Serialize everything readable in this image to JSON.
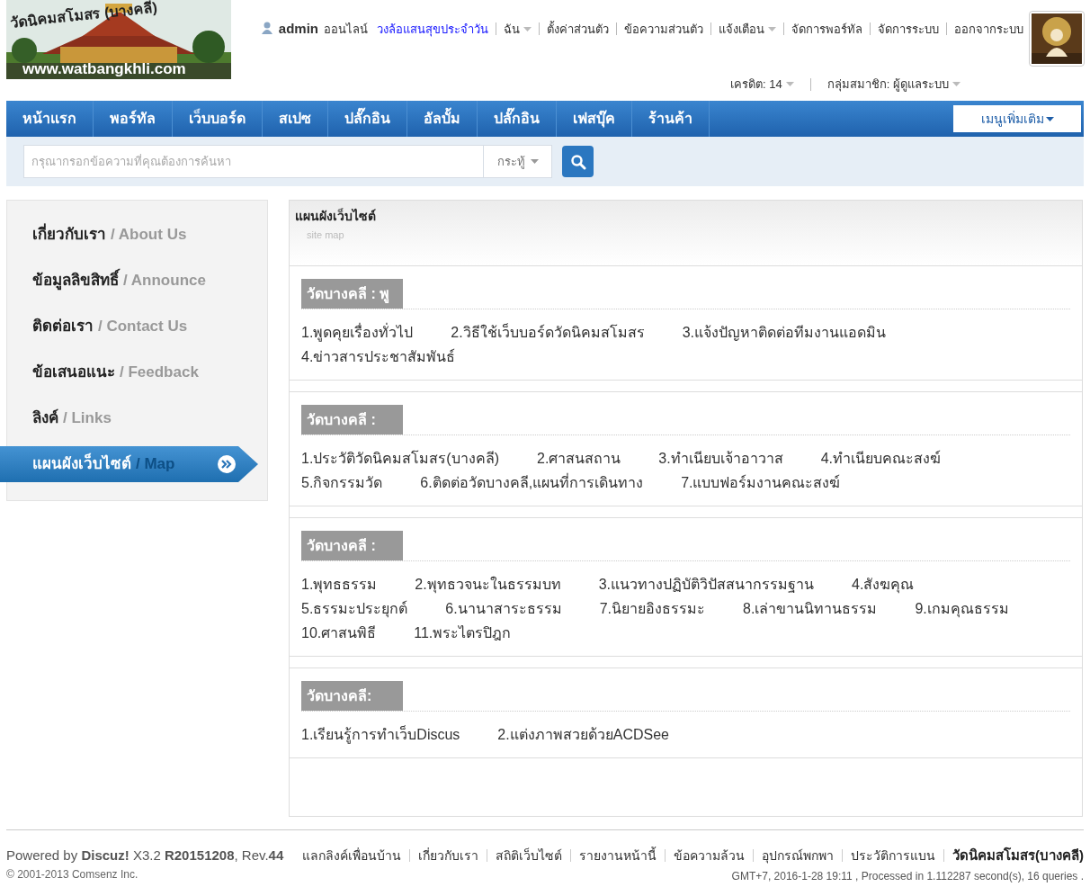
{
  "logo": {
    "title": "วัดนิคมสโมสร (บางคลี)",
    "url": "www.watbangkhli.com"
  },
  "user_bar": {
    "username": "admin",
    "status": "ออนไลน์",
    "highlight_link": "วงล้อแสนสุขประจำวัน",
    "links": [
      {
        "label": "ฉัน",
        "dropdown": true
      },
      {
        "label": "ตั้งค่าส่วนตัว",
        "dropdown": false
      },
      {
        "label": "ข้อความส่วนตัว",
        "dropdown": false
      },
      {
        "label": "แจ้งเตือน",
        "dropdown": true
      },
      {
        "label": "จัดการพอร์ทัล",
        "dropdown": false
      },
      {
        "label": "จัดการระบบ",
        "dropdown": false
      },
      {
        "label": "ออกจากระบบ",
        "dropdown": false
      }
    ],
    "info": [
      {
        "label": "เครดิต: 14",
        "dropdown": true
      },
      {
        "label": "กลุ่มสมาชิก: ผู้ดูแลระบบ",
        "dropdown": true
      }
    ]
  },
  "nav": {
    "items": [
      "หน้าแรก",
      "พอร์ทัล",
      "เว็บบอร์ด",
      "สเปซ",
      "ปลั๊กอิน",
      "อัลบั้ม",
      "ปลั๊กอิน",
      "เฟสบุ๊ค",
      "ร้านค้า"
    ],
    "more_button": "เมนูเพิ่มเติม"
  },
  "search": {
    "placeholder": "กรุณากรอกข้อความที่คุณต้องการค้นหา",
    "scope": "กระทู้"
  },
  "sidebar": {
    "items": [
      {
        "thai": "เกี่ยวกับเรา",
        "english": "/ About Us",
        "selected": false
      },
      {
        "thai": "ข้อมูลลิขสิทธิ์",
        "english": "/ Announce",
        "selected": false
      },
      {
        "thai": "ติดต่อเรา",
        "english": "/ Contact Us",
        "selected": false
      },
      {
        "thai": "ข้อเสนอแนะ",
        "english": "/ Feedback",
        "selected": false
      },
      {
        "thai": "ลิงค์",
        "english": "/ Links",
        "selected": false
      },
      {
        "thai": "แผนผังเว็บไซต์",
        "english": "/ Map",
        "selected": true
      }
    ]
  },
  "content": {
    "title": "แผนผังเว็บไซต์",
    "subtitle": "site map",
    "sections": [
      {
        "heading": "วัดบางคลี : พู",
        "links": [
          "1.พูดคุยเรื่องทั่วไป",
          "2.วิธีใช้เว็บบอร์ดวัดนิคมสโมสร",
          "3.แจ้งปัญหาติดต่อทีมงานแอดมิน",
          "4.ข่าวสารประชาสัมพันธ์"
        ]
      },
      {
        "heading": "วัดบางคลี :",
        "links": [
          "1.ประวัติวัดนิคมสโมสร(บางคลี)",
          "2.ศาสนสถาน",
          "3.ทำเนียบเจ้าอาวาส",
          "4.ทำเนียบคณะสงฆ์",
          "5.กิจกรรมวัด",
          "6.ติดต่อวัดบางคลี,แผนที่การเดินทาง",
          "7.แบบฟอร์มงานคณะสงฆ์"
        ]
      },
      {
        "heading": "วัดบางคลี :",
        "links": [
          "1.พุทธธรรม",
          "2.พุทธวจนะในธรรมบท",
          "3.แนวทางปฏิบัติวิปัสสนากรรมฐาน",
          "4.สังฆคุณ",
          "5.ธรรมะประยุกต์",
          "6.นานาสาระธรรม",
          "7.นิยายอิงธรรมะ",
          "8.เล่าขานนิทานธรรม",
          "9.เกมคุณธรรม",
          "10.ศาสนพิธี",
          "11.พระไตรปิฎก"
        ]
      },
      {
        "heading": "วัดบางคลี:",
        "links": [
          "1.เรียนรู้การทำเว็บDiscus",
          "2.แต่งภาพสวยด้วยACDSee"
        ]
      }
    ]
  },
  "footer": {
    "powered": "Powered by **Discuz!** X3.2 **R20151208**, Rev.**44**",
    "copyright": "© 2001-2013 Comsenz Inc.",
    "links": [
      {
        "label": "แลกลิงค์เพื่อนบ้าน",
        "kind": "link"
      },
      {
        "label": "เกี่ยวกับเรา",
        "kind": "link"
      },
      {
        "label": "สถิติเว็บไซต์",
        "kind": "link"
      },
      {
        "label": "รายงานหน้านี้",
        "kind": "link"
      },
      {
        "label": "ข้อความล้วน",
        "kind": "link"
      },
      {
        "label": "อุปกรณ์พกพา",
        "kind": "link"
      },
      {
        "label": "ประวัติการแบน",
        "kind": "link"
      },
      {
        "label": "วัดนิคมสโมสร(บางคลี)",
        "kind": "site"
      }
    ],
    "stats": "GMT+7, 2016-1-28 19:11 , Processed in 1.112287 second(s), 16 queries ."
  }
}
